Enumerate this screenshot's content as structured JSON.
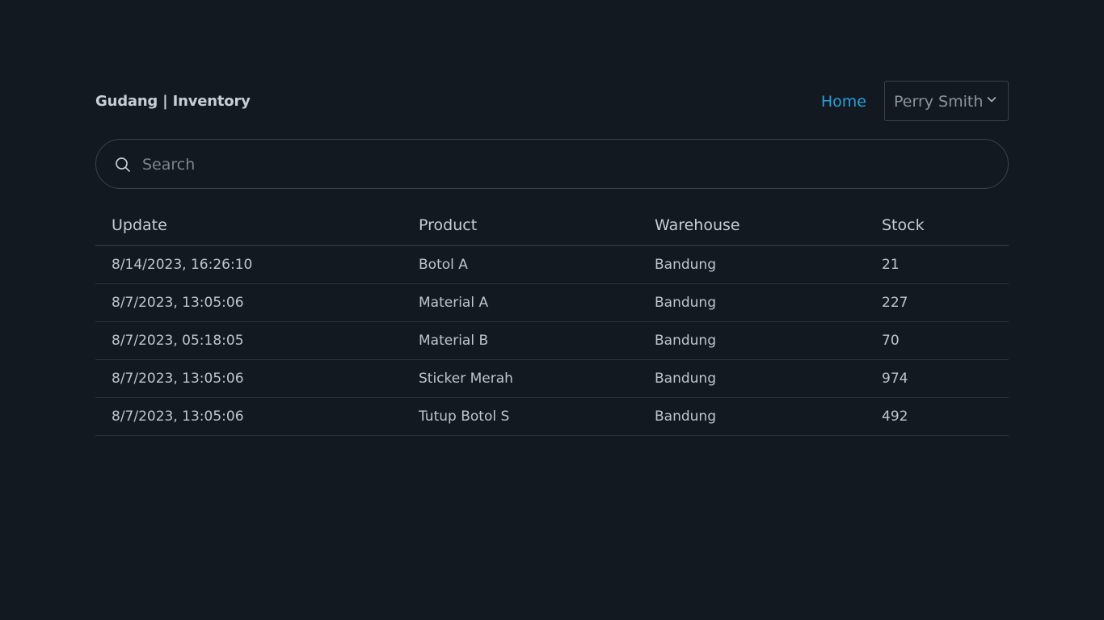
{
  "header": {
    "brand": "Gudang | Inventory",
    "nav_home": "Home",
    "user_name": "Perry Smith"
  },
  "search": {
    "placeholder": "Search",
    "value": ""
  },
  "table": {
    "columns": [
      "Update",
      "Product",
      "Warehouse",
      "Stock"
    ],
    "rows": [
      [
        "8/14/2023, 16:26:10",
        "Botol A",
        "Bandung",
        "21"
      ],
      [
        "8/7/2023, 13:05:06",
        "Material A",
        "Bandung",
        "227"
      ],
      [
        "8/7/2023, 05:18:05",
        "Material B",
        "Bandung",
        "70"
      ],
      [
        "8/7/2023, 13:05:06",
        "Sticker Merah",
        "Bandung",
        "974"
      ],
      [
        "8/7/2023, 13:05:06",
        "Tutup Botol S",
        "Bandung",
        "492"
      ]
    ]
  },
  "icons": {
    "search": "search-icon",
    "dropdown": "chevron-down-icon"
  },
  "colors": {
    "background": "#121921",
    "accent": "#2a9fd6",
    "border": "#39434d"
  }
}
